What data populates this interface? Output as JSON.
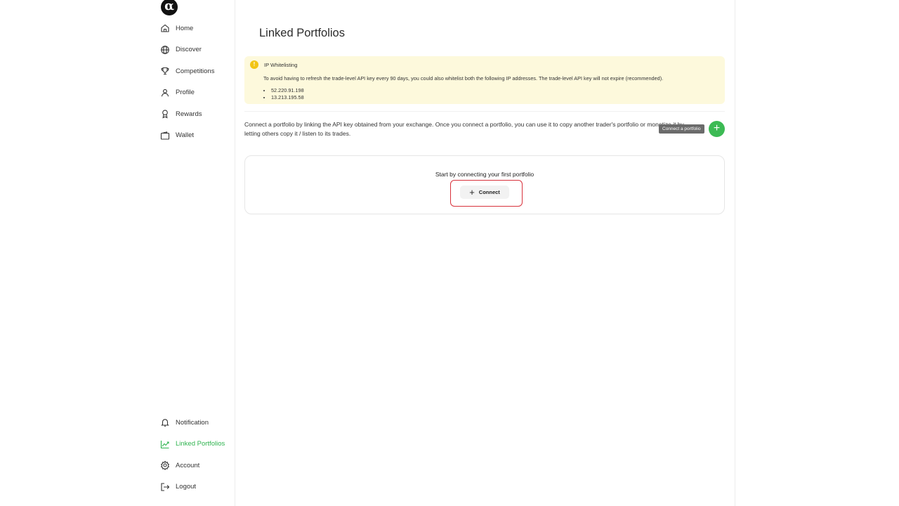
{
  "sidebar": {
    "logo_glyph": "α",
    "top_items": [
      {
        "label": "Home",
        "icon": "home-icon"
      },
      {
        "label": "Discover",
        "icon": "globe-icon"
      },
      {
        "label": "Competitions",
        "icon": "trophy-icon"
      },
      {
        "label": "Profile",
        "icon": "user-icon"
      },
      {
        "label": "Rewards",
        "icon": "award-icon"
      },
      {
        "label": "Wallet",
        "icon": "wallet-icon"
      }
    ],
    "bottom_items": [
      {
        "label": "Notification",
        "icon": "bell-icon"
      },
      {
        "label": "Linked Portfolios",
        "icon": "chart-line-icon",
        "active": true
      },
      {
        "label": "Account",
        "icon": "gear-icon"
      },
      {
        "label": "Logout",
        "icon": "logout-icon"
      }
    ]
  },
  "main": {
    "title": "Linked Portfolios",
    "alert": {
      "icon_glyph": "!",
      "title": "IP Whitelisting",
      "text": "To avoid having to refresh the trade-level API key every 90 days, you could also whitelist both the following IP addresses. The trade-level API key will not expire (recommended).",
      "ips": [
        "52.220.91.198",
        "13.213.195.58"
      ]
    },
    "description": "Connect a portfolio by linking the API key obtained from your exchange. Once you connect a portfolio, you can use it to copy another trader's portfolio or monetize it by letting others copy it / listen to its trades.",
    "add_tooltip": "Connect a portfolio",
    "add_glyph": "+",
    "empty_state": {
      "text": "Start by connecting your first portfolio",
      "button_glyph": "+",
      "button_label": "Connect"
    }
  },
  "colors": {
    "accent": "#3cba54",
    "active_nav": "#2fb34f",
    "alert_bg": "#fdf9dc",
    "alert_icon": "#f2c515",
    "highlight_outline": "#d8323c"
  }
}
